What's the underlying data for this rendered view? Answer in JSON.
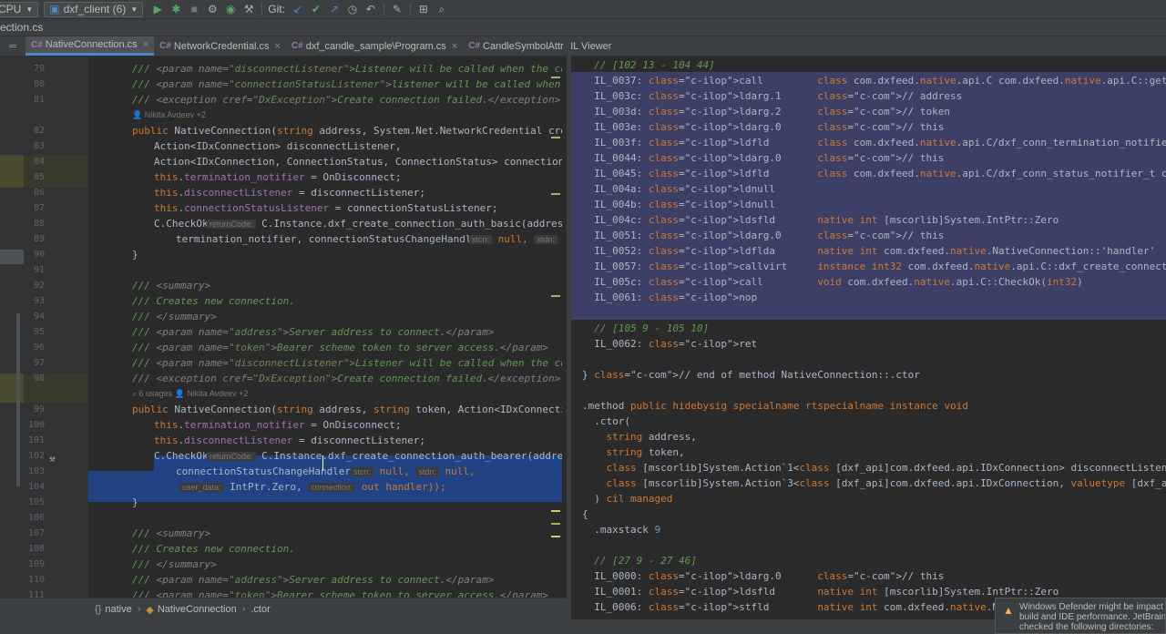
{
  "toolbar": {
    "config_label": "CPU",
    "project_label": "dxf_client (6)",
    "git_label": "Git:"
  },
  "breadcrumb": {
    "file": "ection.cs"
  },
  "tabs": [
    {
      "label": "NativeConnection.cs",
      "active": true
    },
    {
      "label": "NetworkCredential.cs",
      "active": false
    },
    {
      "label": "dxf_candle_sample\\Program.cs",
      "active": false
    },
    {
      "label": "CandleSymbolAttr",
      "active": false
    },
    {
      "label": "IL Viewer",
      "active": false
    }
  ],
  "editor": {
    "line_numbers": [
      "79",
      "80",
      "81",
      "",
      "82",
      "83",
      "84",
      "85",
      "86",
      "87",
      "88",
      "89",
      "90",
      "91",
      "92",
      "93",
      "94",
      "95",
      "96",
      "97",
      "98",
      "",
      "99",
      "100",
      "101",
      "102",
      "103",
      "104",
      "105",
      "106",
      "107",
      "108",
      "109",
      "110",
      "111"
    ],
    "lines": [
      "/// <param name=\"disconnectListener\">Listener will be called when the connecti",
      "/// <param name=\"connectionStatusListener\">listener will be called when the cor",
      "/// <exception cref=\"DxException\">Create connection failed.</exception>",
      "",
      "public NativeConnection(string address, System.Net.NetworkCredential credentia",
      "    Action<IDxConnection> disconnectListener,",
      "    Action<IDxConnection, ConnectionStatus, ConnectionStatus> connectionStatusL",
      "    this.termination_notifier = OnDisconnect;",
      "    this.disconnectListener = disconnectListener;",
      "    this.connectionStatusListener = connectionStatusListener;",
      "    C.CheckOk(",
      "        termination_notifier, connectionStatusChangeHandler,",
      "}",
      "",
      "/// <summary>",
      "/// Creates new connection.",
      "/// </summary>",
      "/// <param name=\"address\">Server address to connect.</param>",
      "/// <param name=\"token\">Bearer scheme token to server access.</param>",
      "/// <param name=\"disconnectListener\">Listener will be called when the connecti",
      "/// <exception cref=\"DxException\">Create connection failed.</exception>",
      "",
      "public NativeConnection(string address, string token, Action<IDxConnection> dis",
      "    this.termination_notifier = OnDisconnect;",
      "    this.disconnectListener = disconnectListener;",
      "    C.CheckOk(",
      "        connectionStatusChangeHandler,",
      "",
      "}",
      "",
      "/// <summary>",
      "/// Creates new connection.",
      "/// </summary>",
      "/// <param name=\"address\">Server address to connect.</param>",
      "/// <param name=\"token\">Bearer scheme token to server access.</param>"
    ],
    "authors_1": "Nikita Avdeev +2",
    "usages": "6 usages",
    "authors_2": "Nikita Avdeev +2",
    "inlay": {
      "returnCode": "returnCode:",
      "stcn": "stcn:",
      "stdn": "stdn:",
      "user_data": "user_data:",
      "connection": "connection:"
    },
    "line88_tail": "C.Instance.dxf_create_connection_auth_basic(address,",
    "line89_tail": "null,",
    "line102_tail": "C.Instance.dxf_create_connection_auth_bearer(address,",
    "line103_tail": "null,",
    "line103_tail2": "null,",
    "line104": "IntPtr.Zero,",
    "line104_tail": "out handler));"
  },
  "il": {
    "lines": [
      "  // [102 13 - 104 44]",
      "  IL_0037: call         class com.dxfeed.native.api.C com.dxfeed.native.api.C::get_Instance()",
      "  IL_003c: ldarg.1      // address",
      "  IL_003d: ldarg.2      // token",
      "  IL_003e: ldarg.0      // this",
      "  IL_003f: ldfld        class com.dxfeed.native.api.C/dxf_conn_termination_notifier_t com.dxfeed.native.Nat",
      "  IL_0044: ldarg.0      // this",
      "  IL_0045: ldfld        class com.dxfeed.native.api.C/dxf_conn_status_notifier_t com.dxfeed.native.NativeCo",
      "  IL_004a: ldnull",
      "  IL_004b: ldnull",
      "  IL_004c: ldsfld       native int [mscorlib]System.IntPtr::Zero",
      "  IL_0051: ldarg.0      // this",
      "  IL_0052: ldflda       native int com.dxfeed.native.NativeConnection::'handler'",
      "  IL_0057: callvirt     instance int32 com.dxfeed.native.api.C::dxf_create_connection_auth_bearer(string, s",
      "  IL_005c: call         void com.dxfeed.native.api.C::CheckOk(int32)",
      "  IL_0061: nop",
      "",
      "  // [105 9 - 105 10]",
      "  IL_0062: ret",
      "",
      "} // end of method NativeConnection::.ctor",
      "",
      ".method public hidebysig specialname rtspecialname instance void",
      "  .ctor(",
      "    string address,",
      "    string token,",
      "    class [mscorlib]System.Action`1<class [dxf_api]com.dxfeed.api.IDxConnection> disconnectListener,",
      "    class [mscorlib]System.Action`3<class [dxf_api]com.dxfeed.api.IDxConnection, valuetype [dxf_api]com.dxf",
      "  ) cil managed",
      "{",
      "  .maxstack 9",
      "",
      "  // [27 9 - 27 46]",
      "  IL_0000: ldarg.0      // this",
      "  IL_0001: ldsfld       native int [mscorlib]System.IntPtr::Zero",
      "  IL_0006: stfld        native int com.dxfeed.native.NativeConnection::'han"
    ]
  },
  "status": {
    "namespace": "native",
    "class": "NativeConnection",
    "member": ".ctor"
  },
  "notification": {
    "line1": "Windows Defender might be impact",
    "line2": "build and IDE performance. JetBrain",
    "line3": "checked the following directories:"
  },
  "colors": {
    "accent": "#4a88c7",
    "selection": "#214283",
    "il_selection": "#3e3f67",
    "background": "#2b2b2b"
  }
}
